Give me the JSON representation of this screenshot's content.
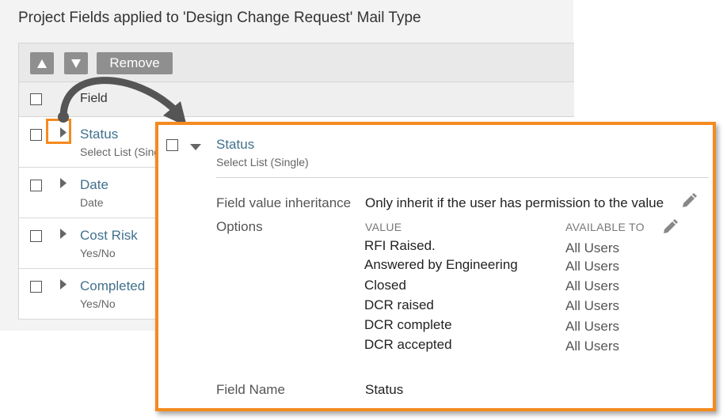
{
  "page": {
    "title": "Project Fields applied to 'Design Change Request' Mail Type"
  },
  "toolbar": {
    "up_label": "▲",
    "down_label": "▼",
    "remove_label": "Remove"
  },
  "grid": {
    "header": {
      "field_label": "Field"
    },
    "rows": [
      {
        "name": "Status",
        "type": "Select List (Single)"
      },
      {
        "name": "Date",
        "type": "Date"
      },
      {
        "name": "Cost Risk",
        "type": "Yes/No"
      },
      {
        "name": "Completed",
        "type": "Yes/No"
      }
    ]
  },
  "detail": {
    "name": "Status",
    "type": "Select List (Single)",
    "inheritance_label": "Field value inheritance",
    "inheritance_value": "Only inherit if the user has permission to the value",
    "options_label": "Options",
    "value_header": "VALUE",
    "available_header": "AVAILABLE TO",
    "options": [
      {
        "value": "RFI Raised.",
        "available": "All Users"
      },
      {
        "value": "Answered by Engineering",
        "available": "All Users"
      },
      {
        "value": "Closed",
        "available": "All Users"
      },
      {
        "value": "DCR raised",
        "available": "All Users"
      },
      {
        "value": "DCR complete",
        "available": "All Users"
      },
      {
        "value": "DCR accepted",
        "available": "All Users"
      }
    ],
    "field_name_label": "Field Name",
    "field_name_value": "Status"
  },
  "colors": {
    "accent": "#f58a1f",
    "link": "#41708e",
    "button": "#8f8f8f"
  },
  "icons": [
    "arrow-up-icon",
    "arrow-down-icon",
    "expand-arrow-icon",
    "collapse-arrow-icon",
    "pencil-icon",
    "callout-arrow-icon"
  ]
}
